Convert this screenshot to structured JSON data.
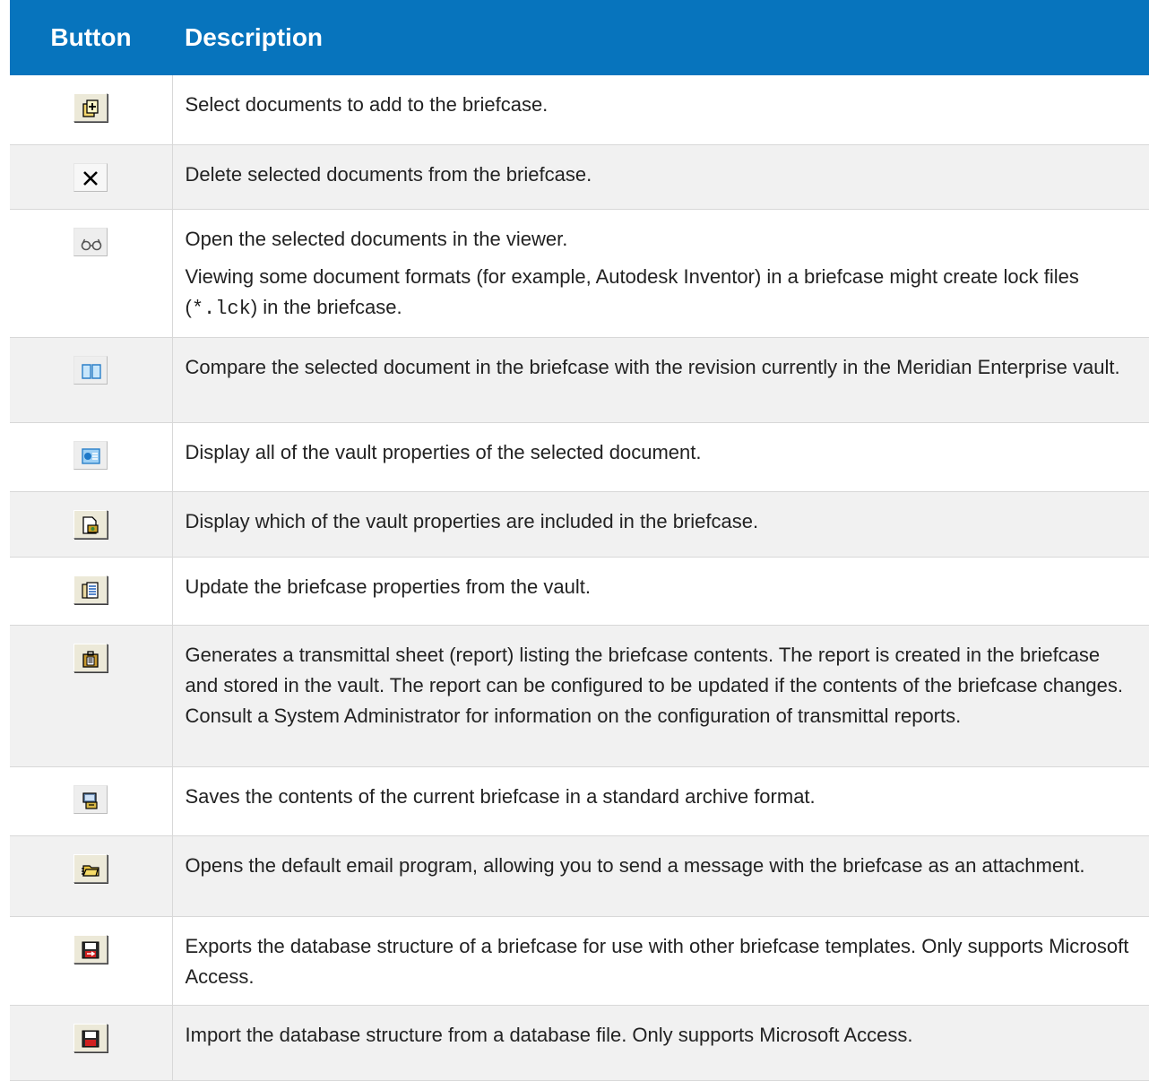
{
  "table": {
    "headers": [
      "Button",
      "Description"
    ],
    "rows": [
      {
        "icon": "add-document-icon",
        "text": [
          "Select documents to add to the briefcase."
        ]
      },
      {
        "icon": "delete-x-icon",
        "text": [
          "Delete selected documents from the briefcase."
        ]
      },
      {
        "icon": "glasses-viewer-icon",
        "text": [
          "Open the selected documents in the viewer.",
          "Viewing some document formats (for example, Autodesk Inventor) in a briefcase might create lock files ("
        ],
        "code": "*.lck",
        "code_suffix": ") in the briefcase."
      },
      {
        "icon": "compare-book-icon",
        "text": [
          "Compare the selected document in the briefcase with the revision currently in the Meridian Enterprise vault."
        ]
      },
      {
        "icon": "properties-icon",
        "text": [
          "Display all of the vault properties of the selected document."
        ]
      },
      {
        "icon": "briefcase-properties-icon",
        "text": [
          "Display which of the vault properties are included in the briefcase."
        ]
      },
      {
        "icon": "update-properties-icon",
        "text": [
          "Update the briefcase properties from the vault."
        ]
      },
      {
        "icon": "transmittal-report-icon",
        "text": [
          "Generates a transmittal sheet (report) listing the briefcase contents. The report is created in the briefcase and stored in the vault. The report can be configured to be updated if the contents of the briefcase changes. Consult a System Administrator for information on the configuration of transmittal reports."
        ]
      },
      {
        "icon": "archive-save-icon",
        "text": [
          "Saves the contents of the current briefcase in a standard archive format."
        ]
      },
      {
        "icon": "email-send-icon",
        "text": [
          "Opens the default email program, allowing you to send a message with the briefcase as an attachment."
        ]
      },
      {
        "icon": "export-database-icon",
        "text": [
          "Exports the database structure of a briefcase for use with other briefcase templates. Only supports Microsoft Access."
        ]
      },
      {
        "icon": "import-database-icon",
        "text": [
          "Import the database structure from a database file. Only supports Microsoft Access."
        ]
      }
    ]
  },
  "colors": {
    "header_bg": "#0774bd",
    "header_text": "#ffffff",
    "row_alt": "#f1f1f1"
  }
}
